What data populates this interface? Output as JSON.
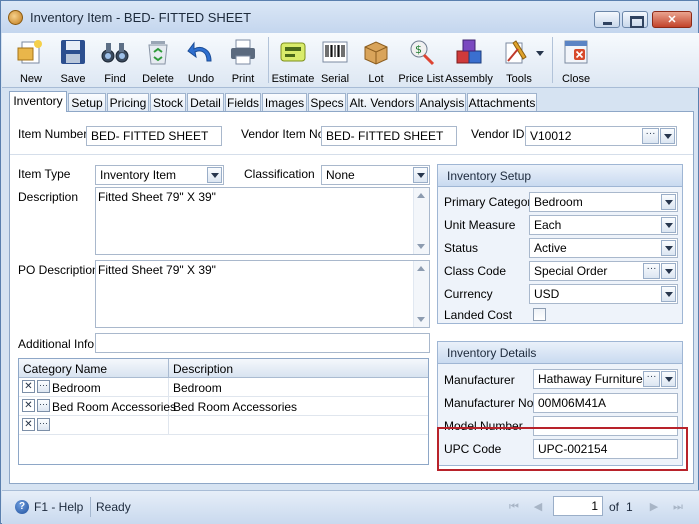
{
  "window": {
    "title": "Inventory Item - BED- FITTED SHEET"
  },
  "toolbar": {
    "new": "New",
    "save": "Save",
    "find": "Find",
    "delete": "Delete",
    "undo": "Undo",
    "print": "Print",
    "estimate": "Estimate",
    "serial": "Serial",
    "lot": "Lot",
    "price_list": "Price List",
    "assembly": "Assembly",
    "tools": "Tools",
    "close": "Close"
  },
  "tabs": [
    "Inventory",
    "Setup",
    "Pricing",
    "Stock",
    "Detail",
    "Fields",
    "Images",
    "Specs",
    "Alt. Vendors",
    "Analysis",
    "Attachments"
  ],
  "header": {
    "item_number_label": "Item Number",
    "item_number": "BED- FITTED SHEET",
    "vendor_item_no_label": "Vendor Item No",
    "vendor_item_no": "BED- FITTED SHEET",
    "vendor_id_label": "Vendor ID",
    "vendor_id": "V10012"
  },
  "form": {
    "item_type_label": "Item Type",
    "item_type": "Inventory Item",
    "classification_label": "Classification",
    "classification": "None",
    "description_label": "Description",
    "description": "Fitted Sheet 79\" X 39\"",
    "po_description_label": "PO Description",
    "po_description": "Fitted Sheet 79\" X 39\"",
    "additional_info_label": "Additional Info",
    "additional_info": ""
  },
  "grid": {
    "headers": [
      "Category Name",
      "Description"
    ],
    "rows": [
      {
        "category": "Bedroom",
        "description": "Bedroom"
      },
      {
        "category": "Bed Room Accessories",
        "description": "Bed Room Accessories"
      }
    ]
  },
  "inventory_setup": {
    "title": "Inventory Setup",
    "primary_category_label": "Primary Category",
    "primary_category": "Bedroom",
    "unit_measure_label": "Unit Measure",
    "unit_measure": "Each",
    "status_label": "Status",
    "status": "Active",
    "class_code_label": "Class Code",
    "class_code": "Special Order",
    "currency_label": "Currency",
    "currency": "USD",
    "landed_cost_label": "Landed Cost"
  },
  "inventory_details": {
    "title": "Inventory Details",
    "manufacturer_label": "Manufacturer",
    "manufacturer": "Hathaway Furniture Wa",
    "manufacturer_no_label": "Manufacturer No",
    "manufacturer_no": "00M06M41A",
    "model_number_label": "Model Number",
    "model_number": "",
    "upc_code_label": "UPC Code",
    "upc_code": "UPC-002154"
  },
  "status_bar": {
    "help": "F1 - Help",
    "status": "Ready",
    "page": "1",
    "of_label": "of",
    "total_pages": "1"
  },
  "colors": {
    "highlight": "#b8222a",
    "chrome": "#d6e3f2"
  }
}
